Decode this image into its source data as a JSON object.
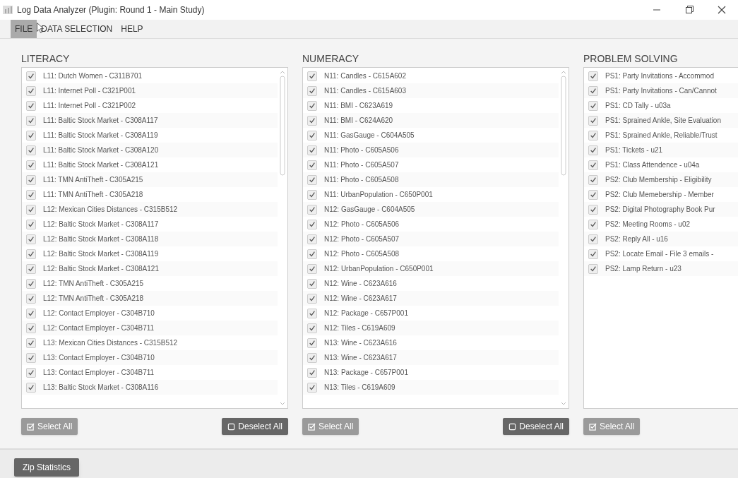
{
  "window": {
    "title": "Log Data Analyzer (Plugin: Round 1 - Main Study)"
  },
  "menu": [
    {
      "label": "FILE",
      "selected": true
    },
    {
      "label": "DATA SELECTION",
      "selected": false
    },
    {
      "label": "HELP",
      "selected": false
    }
  ],
  "panels": [
    {
      "heading": "LITERACY",
      "scrollbar": true,
      "items": [
        {
          "label": "L11: Dutch Women - C311B701",
          "checked": true
        },
        {
          "label": "L11: Internet Poll - C321P001",
          "checked": true
        },
        {
          "label": "L11: Internet Poll - C321P002",
          "checked": true
        },
        {
          "label": "L11: Baltic Stock Market - C308A117",
          "checked": true
        },
        {
          "label": "L11: Baltic Stock Market - C308A119",
          "checked": true
        },
        {
          "label": "L11: Baltic Stock Market - C308A120",
          "checked": true
        },
        {
          "label": "L11: Baltic Stock Market - C308A121",
          "checked": true
        },
        {
          "label": "L11: TMN AntiTheft - C305A215",
          "checked": true
        },
        {
          "label": "L11: TMN AntiTheft - C305A218",
          "checked": true
        },
        {
          "label": "L12: Mexican Cities Distances - C315B512",
          "checked": true
        },
        {
          "label": "L12: Baltic Stock Market - C308A117",
          "checked": true
        },
        {
          "label": "L12: Baltic Stock Market - C308A118",
          "checked": true
        },
        {
          "label": "L12: Baltic Stock Market - C308A119",
          "checked": true
        },
        {
          "label": "L12: Baltic Stock Market - C308A121",
          "checked": true
        },
        {
          "label": "L12: TMN AntiTheft - C305A215",
          "checked": true
        },
        {
          "label": "L12: TMN AntiTheft - C305A218",
          "checked": true
        },
        {
          "label": "L12: Contact Employer - C304B710",
          "checked": true
        },
        {
          "label": "L12: Contact Employer - C304B711",
          "checked": true
        },
        {
          "label": "L13: Mexican Cities Distances - C315B512",
          "checked": true
        },
        {
          "label": "L13: Contact Employer - C304B710",
          "checked": true
        },
        {
          "label": "L13: Contact Employer - C304B711",
          "checked": true
        },
        {
          "label": "L13: Baltic Stock Market - C308A116",
          "checked": true
        }
      ],
      "buttons": [
        {
          "label": "Select All",
          "kind": "select",
          "disabled": true
        },
        {
          "label": "Deselect All",
          "kind": "deselect",
          "disabled": false
        }
      ]
    },
    {
      "heading": "NUMERACY",
      "scrollbar": true,
      "items": [
        {
          "label": "N11: Candles - C615A602",
          "checked": true
        },
        {
          "label": "N11: Candles - C615A603",
          "checked": true
        },
        {
          "label": "N11: BMI - C623A619",
          "checked": true
        },
        {
          "label": "N11: BMI - C624A620",
          "checked": true
        },
        {
          "label": "N11: GasGauge - C604A505",
          "checked": true
        },
        {
          "label": "N11: Photo - C605A506",
          "checked": true
        },
        {
          "label": "N11: Photo - C605A507",
          "checked": true
        },
        {
          "label": "N11: Photo - C605A508",
          "checked": true
        },
        {
          "label": "N11: UrbanPopulation - C650P001",
          "checked": true
        },
        {
          "label": "N12: GasGauge - C604A505",
          "checked": true
        },
        {
          "label": "N12: Photo - C605A506",
          "checked": true
        },
        {
          "label": "N12: Photo - C605A507",
          "checked": true
        },
        {
          "label": "N12: Photo - C605A508",
          "checked": true
        },
        {
          "label": "N12: UrbanPopulation - C650P001",
          "checked": true
        },
        {
          "label": "N12: Wine - C623A616",
          "checked": true
        },
        {
          "label": "N12: Wine - C623A617",
          "checked": true
        },
        {
          "label": "N12: Package - C657P001",
          "checked": true
        },
        {
          "label": "N12: Tiles - C619A609",
          "checked": true
        },
        {
          "label": "N13: Wine - C623A616",
          "checked": true
        },
        {
          "label": "N13: Wine - C623A617",
          "checked": true
        },
        {
          "label": "N13: Package - C657P001",
          "checked": true
        },
        {
          "label": "N13: Tiles - C619A609",
          "checked": true
        }
      ],
      "buttons": [
        {
          "label": "Select All",
          "kind": "select",
          "disabled": true
        },
        {
          "label": "Deselect All",
          "kind": "deselect",
          "disabled": false
        }
      ]
    },
    {
      "heading": "PROBLEM SOLVING",
      "scrollbar": false,
      "items": [
        {
          "label": "PS1: Party Invitations - Accommod",
          "checked": true
        },
        {
          "label": "PS1: Party Invitations - Can/Cannot",
          "checked": true
        },
        {
          "label": "PS1: CD Tally - u03a",
          "checked": true
        },
        {
          "label": "PS1: Sprained Ankle, Site Evaluation",
          "checked": true
        },
        {
          "label": "PS1: Sprained Ankle, Reliable/Trust",
          "checked": true
        },
        {
          "label": "PS1: Tickets - u21",
          "checked": true
        },
        {
          "label": "PS1: Class Attendence - u04a",
          "checked": true
        },
        {
          "label": "PS2: Club Membership - Eligibility",
          "checked": true
        },
        {
          "label": "PS2: Club Memebership - Member",
          "checked": true
        },
        {
          "label": "PS2: Digital Photography Book Pur",
          "checked": true
        },
        {
          "label": "PS2: Meeting Rooms - u02",
          "checked": true
        },
        {
          "label": "PS2: Reply All - u16",
          "checked": true
        },
        {
          "label": "PS2: Locate Email - File 3 emails -",
          "checked": true
        },
        {
          "label": "PS2: Lamp Return - u23",
          "checked": true
        }
      ],
      "buttons": [
        {
          "label": "Select All",
          "kind": "select",
          "disabled": true
        }
      ]
    }
  ],
  "footer_button": "Zip Statistics"
}
